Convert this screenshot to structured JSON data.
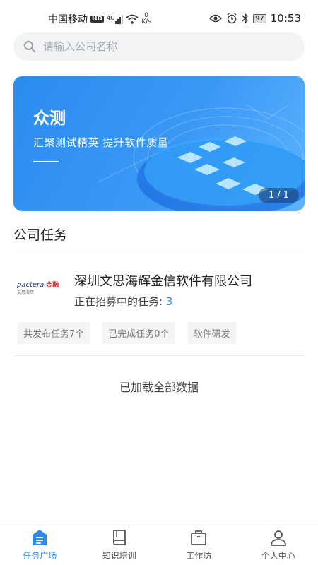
{
  "status_bar": {
    "carrier": "中国移动",
    "hd": "HD",
    "network": "4G",
    "speed_value": "0",
    "speed_unit": "K/s",
    "battery": "97",
    "time": "10:53"
  },
  "search": {
    "placeholder": "请输入公司名称"
  },
  "banner": {
    "title": "众测",
    "subtitle": "汇聚测试精英  提升软件质量",
    "pager": "1 / 1"
  },
  "section": {
    "title": "公司任务"
  },
  "company": {
    "logo_text": "pactera",
    "logo_suffix": "金融",
    "logo_sub": "文思海辉",
    "name": "深圳文思海辉金信软件有限公司",
    "recruiting_label": "正在招募中的任务:",
    "recruiting_count": "3",
    "tags": [
      "共发布任务7个",
      "已完成任务0个",
      "软件研发"
    ]
  },
  "list_footer": "已加载全部数据",
  "tabbar": {
    "items": [
      {
        "label": "任务广场",
        "icon": "task-square-icon",
        "active": true
      },
      {
        "label": "知识培训",
        "icon": "book-icon",
        "active": false
      },
      {
        "label": "工作坊",
        "icon": "briefcase-icon",
        "active": false
      },
      {
        "label": "个人中心",
        "icon": "person-icon",
        "active": false
      }
    ]
  },
  "colors": {
    "accent": "#2f8ae5",
    "banner": "#2b8cf0"
  }
}
